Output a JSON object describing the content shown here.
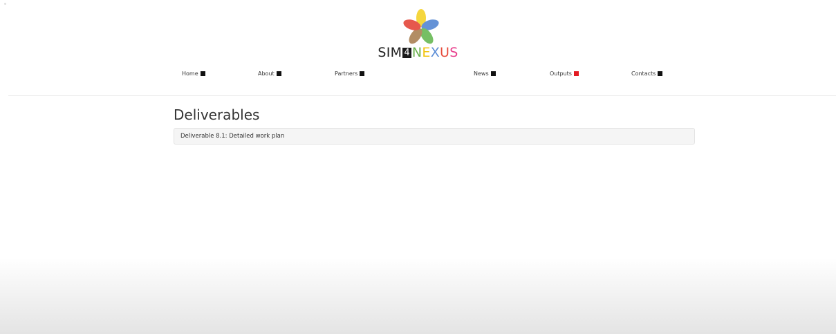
{
  "logo": {
    "text_part1": "SIM",
    "text_part2": "4",
    "text_part3": "NEXUS",
    "colors": {
      "yellow": "#f4d01c",
      "blue": "#4a7fd0",
      "green": "#5fb54a",
      "red": "#e23b2e",
      "brown": "#a57a4a",
      "n": "#6ab04c",
      "e": "#f1c40f",
      "x": "#5b8dd6",
      "u": "#e74c3c",
      "s": "#e83e8c"
    }
  },
  "nav": {
    "items": [
      {
        "label": "Home"
      },
      {
        "label": "About"
      },
      {
        "label": "Partners"
      },
      {
        "label": "News"
      },
      {
        "label": "Outputs",
        "active": true
      },
      {
        "label": "Contacts"
      }
    ],
    "active_color": "#e31b23"
  },
  "main": {
    "title": "Deliverables",
    "deliverables": [
      {
        "label": "Deliverable 8.1: Detailed work plan"
      }
    ]
  }
}
